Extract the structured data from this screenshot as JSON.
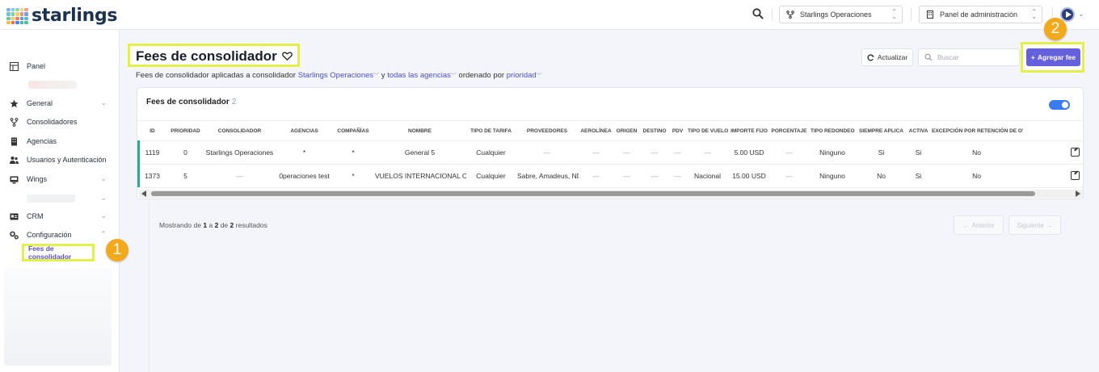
{
  "app": {
    "brand": "starlings"
  },
  "topbar": {
    "company_select": "Starlings Operaciones",
    "panel_select": "Panel de administración"
  },
  "sidebar": {
    "items": [
      {
        "label": "Panel"
      },
      {
        "label": "General"
      },
      {
        "label": "Consolidadores"
      },
      {
        "label": "Agencias"
      },
      {
        "label": "Usuarios y Autenticación"
      },
      {
        "label": "Wings"
      },
      {
        "label": "CRM"
      },
      {
        "label": "Configuración"
      }
    ],
    "active_sub_item": "Fees de consolidador"
  },
  "badges": {
    "step1": "1",
    "step2": "2"
  },
  "page": {
    "title": "Fees de consolidador",
    "subtitle_prefix": "Fees de consolidador aplicadas a consolidador",
    "consolidator_link": "Starlings Operaciones",
    "subtitle_and": "y",
    "agencies_link": "todas las agencias",
    "subtitle_order": "ordenado por",
    "order_link": "prioridad",
    "refresh_label": "Actualizar",
    "search_placeholder": "Buscar",
    "add_label": "Agregar fee"
  },
  "card": {
    "title": "Fees de consolidador",
    "count": "2",
    "toggle_on": true
  },
  "table": {
    "columns": [
      "ID",
      "Prioridad",
      "Consolidador",
      "Agencias",
      "Compañías",
      "Nombre",
      "Tipo de tarifa",
      "Proveedores",
      "Aerolínea",
      "Origen",
      "Destino",
      "PDV",
      "Tipo de vuelo",
      "Importe fijo",
      "Porcentaje",
      "Tipo redondeo",
      "Siempre aplica",
      "Activa",
      "Excepción por retención de over"
    ],
    "rows": [
      [
        "1119",
        "0",
        "Starlings Operaciones",
        "*",
        "*",
        "General 5",
        "Cualquier",
        "---",
        "---",
        "---",
        "---",
        "---",
        "---",
        "5.00 USD",
        "---",
        "Ninguno",
        "Si",
        "Si",
        "No"
      ],
      [
        "1373",
        "5",
        "---",
        "0peraciones test",
        "*",
        "VUELOS INTERNACIONAL CABOTAJE",
        "Cualquier",
        "Sabre, Amadeus, NDC",
        "---",
        "---",
        "---",
        "---",
        "Nacional",
        "15.00 USD",
        "---",
        "Ninguno",
        "No",
        "Si",
        "No"
      ]
    ]
  },
  "pagination": {
    "prefix": "Mostrando de",
    "from": "1",
    "sep1": "a",
    "to": "2",
    "sep2": "de",
    "total": "2",
    "suffix": "resultados",
    "prev_label": "Anterior",
    "next_label": "Siguiente"
  },
  "colors": {
    "accent": "#6560dc",
    "highlight": "#e5ef4a",
    "badge": "#f2a91c",
    "row_accent": "#27b085",
    "toggle": "#3a7cf0"
  }
}
